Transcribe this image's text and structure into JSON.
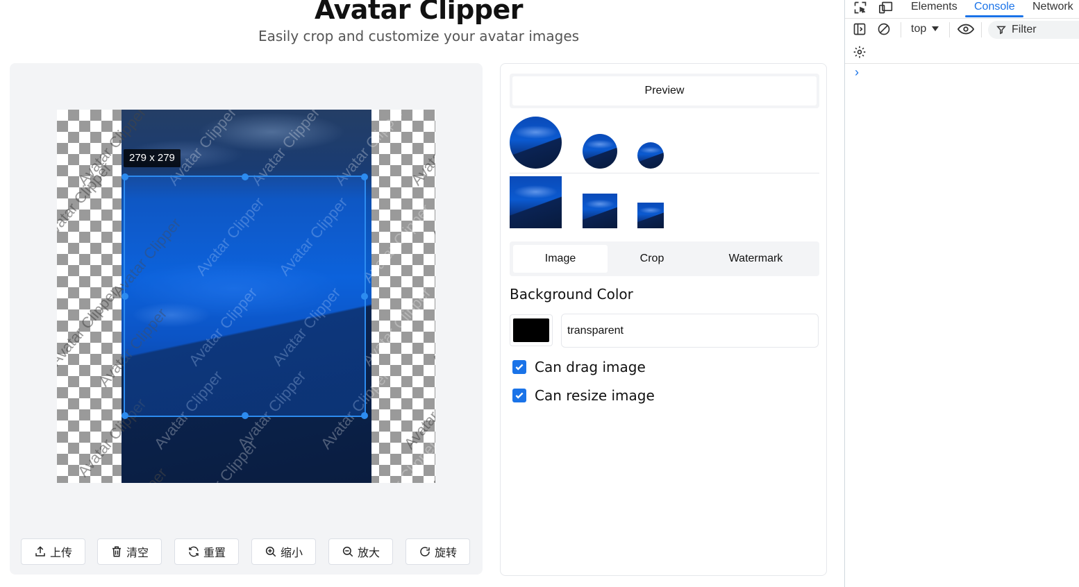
{
  "header": {
    "title": "Avatar Clipper",
    "subtitle": "Easily crop and customize your avatar images"
  },
  "canvas": {
    "crop_size_label": "279 x 279",
    "watermark_text": "Avatar Clipper"
  },
  "toolbar": [
    {
      "icon": "upload-icon",
      "label": "上传"
    },
    {
      "icon": "trash-icon",
      "label": "清空"
    },
    {
      "icon": "refresh-icon",
      "label": "重置"
    },
    {
      "icon": "zoom-in-icon",
      "label": "缩小"
    },
    {
      "icon": "zoom-out-icon",
      "label": "放大"
    },
    {
      "icon": "rotate-icon",
      "label": "旋转"
    }
  ],
  "preview": {
    "label": "Preview"
  },
  "tabs": [
    {
      "label": "Image",
      "active": true
    },
    {
      "label": "Crop",
      "active": false
    },
    {
      "label": "Watermark",
      "active": false
    }
  ],
  "settings": {
    "background_label": "Background Color",
    "background_value": "transparent",
    "swatch_color": "#000000",
    "can_drag_label": "Can drag image",
    "can_drag_checked": true,
    "can_resize_label": "Can resize image",
    "can_resize_checked": true
  },
  "devtools": {
    "tabs": [
      "Elements",
      "Console",
      "Network"
    ],
    "active_tab": "Console",
    "context": "top",
    "filter_label": "Filter",
    "prompt": "›"
  },
  "colors": {
    "accent": "#2d8cf0",
    "devtools_accent": "#1a73e8",
    "checkbox": "#1a73e8"
  }
}
